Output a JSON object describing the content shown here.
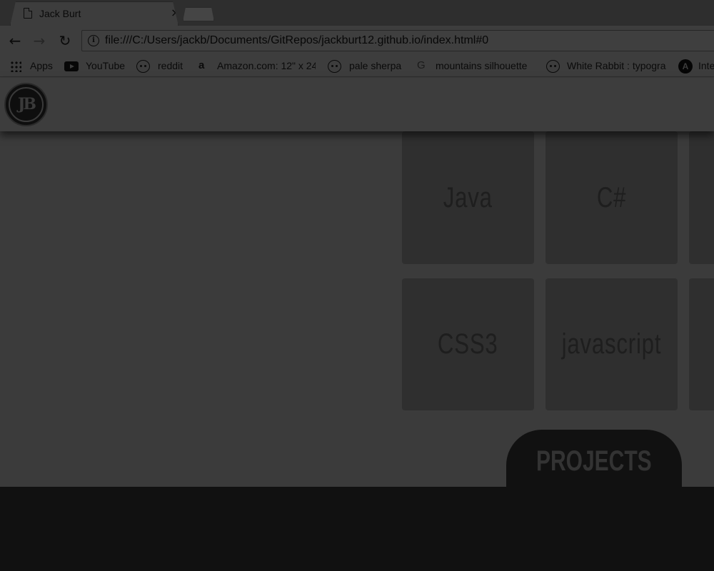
{
  "browser": {
    "tab_title": "Jack Burt",
    "tab_close": "×",
    "url": "file:///C:/Users/jackb/Documents/GitRepos/jackburt12.github.io/index.html#0",
    "bookmarks": [
      {
        "label": "Apps",
        "icon": "apps-grid-icon"
      },
      {
        "label": "YouTube",
        "icon": "youtube-icon"
      },
      {
        "label": "reddit",
        "icon": "reddit-icon"
      },
      {
        "label": "Amazon.com: 12\" x 24",
        "icon": "amazon-icon"
      },
      {
        "label": "pale sherpa",
        "icon": "reddit-icon"
      },
      {
        "label": "mountains silhouette",
        "icon": "google-icon"
      },
      {
        "label": "White Rabbit : typogra",
        "icon": "reddit-icon"
      },
      {
        "label": "Inter",
        "icon": "a-icon"
      }
    ]
  },
  "site": {
    "logo_text": "JB",
    "skills": [
      "Java",
      "C#",
      "CSS3",
      "javascript"
    ],
    "projects_label": "PROJECTS"
  }
}
